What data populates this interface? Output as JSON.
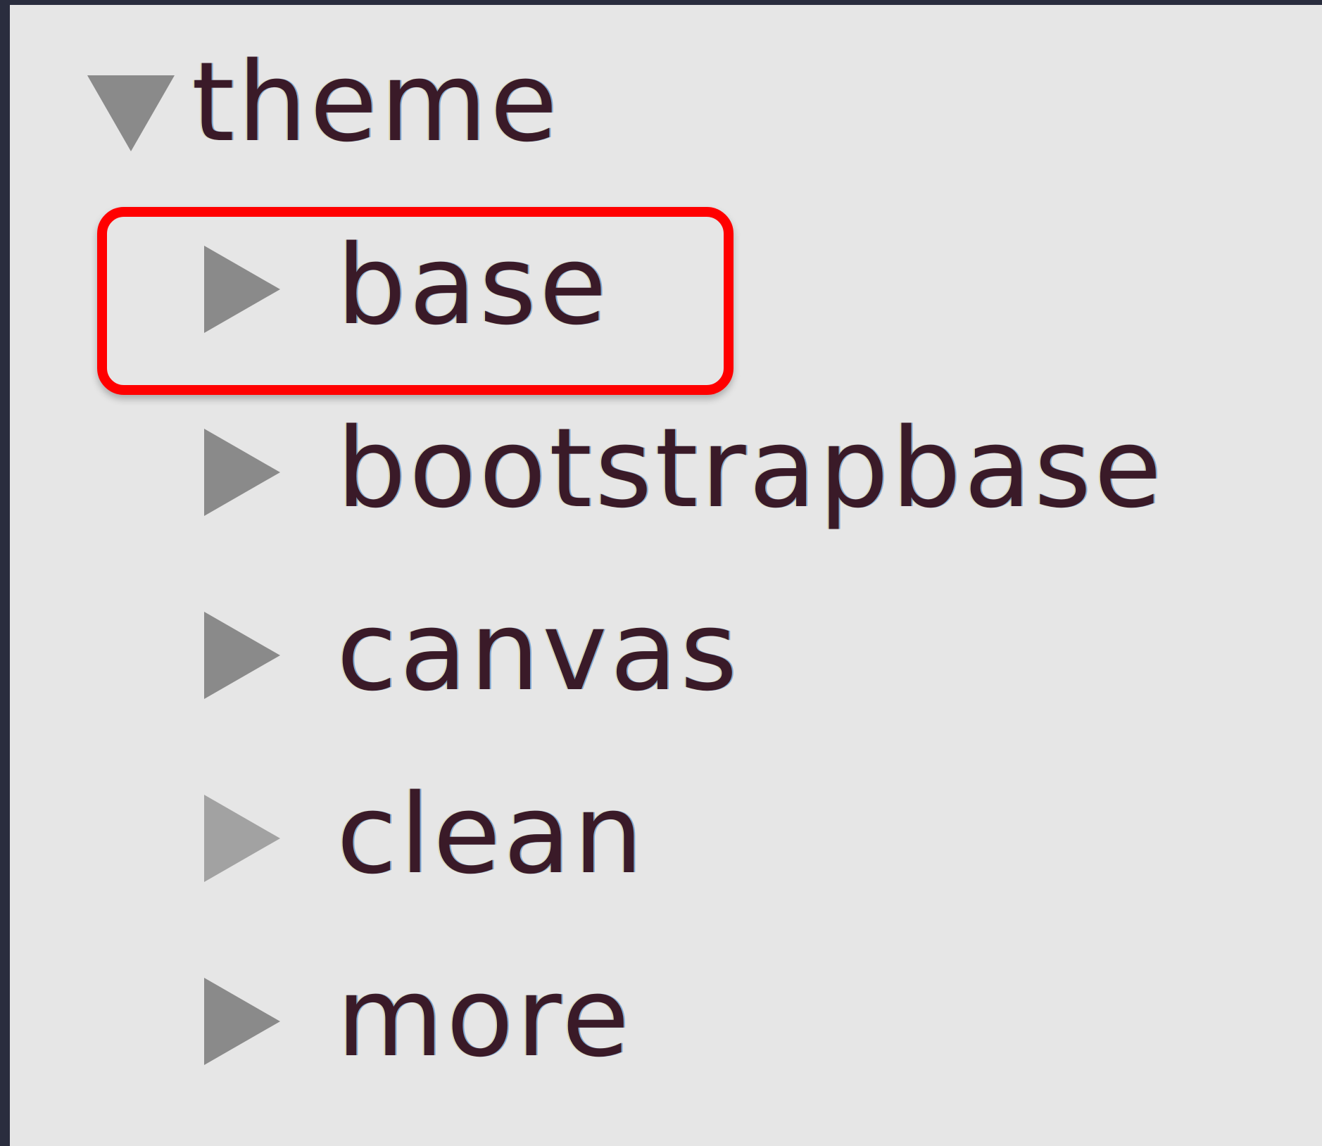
{
  "tree": {
    "root": {
      "label": "theme",
      "icon": "chevron-down-icon",
      "expanded": true
    },
    "children": [
      {
        "label": "base",
        "icon": "chevron-right-icon",
        "expanded": false,
        "highlighted": true
      },
      {
        "label": "bootstrapbase",
        "icon": "chevron-right-icon",
        "expanded": false
      },
      {
        "label": "canvas",
        "icon": "chevron-right-icon",
        "expanded": false
      },
      {
        "label": "clean",
        "icon": "chevron-right-icon",
        "expanded": false
      },
      {
        "label": "more",
        "icon": "chevron-right-icon",
        "expanded": false
      }
    ]
  },
  "colors": {
    "panel_background": "#e6e6e6",
    "frame_background": "#2a2d3e",
    "twisty": "#8a8a8a",
    "highlight": "#ff0000"
  }
}
